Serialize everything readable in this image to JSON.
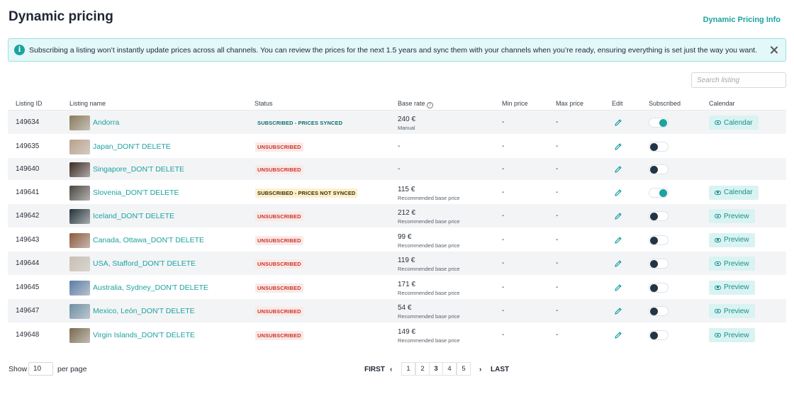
{
  "header": {
    "title": "Dynamic pricing",
    "info_link": "Dynamic Pricing Info"
  },
  "banner": {
    "text": "Subscribing a listing won’t instantly update prices across all channels. You can review the prices for the next 1.5 years and sync them with your channels when you’re ready, ensuring everything is set just the way you want."
  },
  "search": {
    "placeholder": "Search listing"
  },
  "columns": {
    "id": "Listing ID",
    "name": "Listing name",
    "status": "Status",
    "base_rate": "Base rate",
    "min_price": "Min price",
    "max_price": "Max price",
    "edit": "Edit",
    "subscribed": "Subscribed",
    "calendar": "Calendar"
  },
  "rows": [
    {
      "id": "149634",
      "name": "Andorra",
      "status": "SUBSCRIBED - PRICES SYNCED",
      "status_kind": "synced",
      "rate": "240 €",
      "rate_note": "Manual",
      "min": "-",
      "max": "-",
      "subscribed": true,
      "action": "Calendar",
      "thumb": "#8a7a5a"
    },
    {
      "id": "149635",
      "name": "Japan_DON'T DELETE",
      "status": "UNSUBSCRIBED",
      "status_kind": "unsub",
      "rate": "-",
      "rate_note": "",
      "min": "-",
      "max": "-",
      "subscribed": false,
      "action": "",
      "thumb": "#b9a08a"
    },
    {
      "id": "149640",
      "name": "Singapore_DON'T DELETE",
      "status": "UNSUBSCRIBED",
      "status_kind": "unsub",
      "rate": "-",
      "rate_note": "",
      "min": "-",
      "max": "-",
      "subscribed": false,
      "action": "",
      "thumb": "#3b2a22"
    },
    {
      "id": "149641",
      "name": "Slovenia_DON'T DELETE",
      "status": "SUBSCRIBED - PRICES NOT SYNCED",
      "status_kind": "notsync",
      "rate": "115 €",
      "rate_note": "Recommended base price",
      "min": "-",
      "max": "-",
      "subscribed": true,
      "action": "Calendar",
      "thumb": "#4a4540"
    },
    {
      "id": "149642",
      "name": "Iceland_DON'T DELETE",
      "status": "UNSUBSCRIBED",
      "status_kind": "unsub",
      "rate": "212 €",
      "rate_note": "Recommended base price",
      "min": "-",
      "max": "-",
      "subscribed": false,
      "action": "Preview",
      "thumb": "#22323a"
    },
    {
      "id": "149643",
      "name": "Canada, Ottawa_DON'T DELETE",
      "status": "UNSUBSCRIBED",
      "status_kind": "unsub",
      "rate": "99 €",
      "rate_note": "Recommended base price",
      "min": "-",
      "max": "-",
      "subscribed": false,
      "action": "Preview",
      "thumb": "#8c5a3c"
    },
    {
      "id": "149644",
      "name": "USA, Stafford_DON'T DELETE",
      "status": "UNSUBSCRIBED",
      "status_kind": "unsub",
      "rate": "119 €",
      "rate_note": "Recommended base price",
      "min": "-",
      "max": "-",
      "subscribed": false,
      "action": "Preview",
      "thumb": "#c9bfb3"
    },
    {
      "id": "149645",
      "name": "Australia, Sydney_DON'T DELETE",
      "status": "UNSUBSCRIBED",
      "status_kind": "unsub",
      "rate": "171 €",
      "rate_note": "Recommended base price",
      "min": "-",
      "max": "-",
      "subscribed": false,
      "action": "Preview",
      "thumb": "#5a7da6"
    },
    {
      "id": "149647",
      "name": "Mexico, León_DON'T DELETE",
      "status": "UNSUBSCRIBED",
      "status_kind": "unsub",
      "rate": "54 €",
      "rate_note": "Recommended base price",
      "min": "-",
      "max": "-",
      "subscribed": false,
      "action": "Preview",
      "thumb": "#6e8fa3"
    },
    {
      "id": "149648",
      "name": "Virgin Islands_DON'T DELETE",
      "status": "UNSUBSCRIBED",
      "status_kind": "unsub",
      "rate": "149 €",
      "rate_note": "Recommended base price",
      "min": "-",
      "max": "-",
      "subscribed": false,
      "action": "Preview",
      "thumb": "#7a6a4e"
    }
  ],
  "footer": {
    "show": "Show",
    "per_page_value": "10",
    "per_page": "per page",
    "first": "FIRST",
    "last": "LAST",
    "prev": "‹",
    "next": "›",
    "pages": [
      "1",
      "2",
      "3",
      "4",
      "5"
    ],
    "active_page": "3"
  },
  "colors": {
    "accent": "#1aa3a0",
    "unsubscribed": "#c8352b",
    "not_synced_bg": "#fdf0c9"
  }
}
